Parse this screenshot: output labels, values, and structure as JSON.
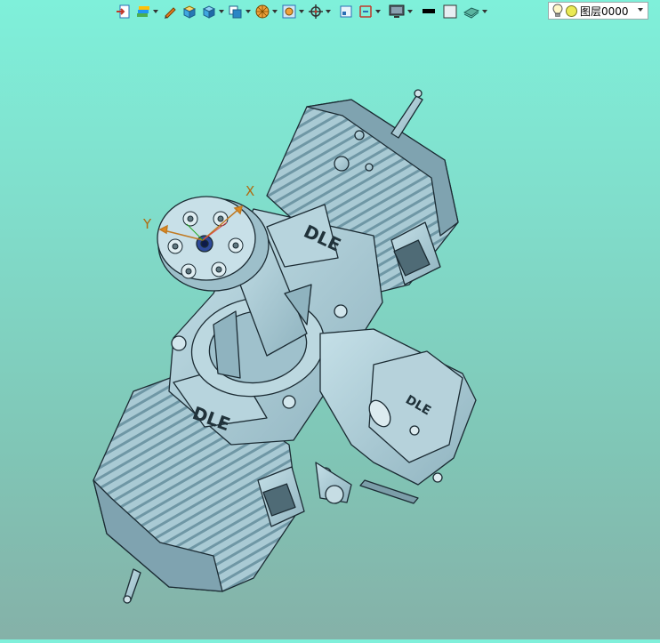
{
  "toolbar": {
    "buttons": [
      {
        "icon": "import-icon",
        "dropdown": false
      },
      {
        "icon": "layers-color-icon",
        "dropdown": true
      },
      {
        "icon": "pencil-icon",
        "dropdown": false
      },
      {
        "icon": "solid-box-icon",
        "dropdown": false
      },
      {
        "icon": "view-cube-icon",
        "dropdown": true
      },
      {
        "icon": "shaded-cube-icon",
        "dropdown": true
      },
      {
        "icon": "render-sphere-icon",
        "dropdown": true
      },
      {
        "icon": "image-frame-icon",
        "dropdown": true
      },
      {
        "icon": "crosshair-icon",
        "dropdown": true
      },
      {
        "icon": "frame-icon",
        "dropdown": false
      },
      {
        "icon": "dimension-icon",
        "dropdown": true
      },
      {
        "icon": "monitor-icon",
        "dropdown": true
      },
      {
        "icon": "line-color-icon",
        "dropdown": false
      },
      {
        "icon": "fill-color-icon",
        "dropdown": false
      },
      {
        "icon": "plane-icon",
        "dropdown": true
      }
    ]
  },
  "layer": {
    "label": "图层0000",
    "color": "#eaea55"
  },
  "model": {
    "engraving_top": "DLE",
    "engraving_bottom": "DLE",
    "engraving_carb": "DLE"
  },
  "axes": {
    "x_label": "X",
    "y_label": "Y"
  },
  "colors": {
    "background_top": "#7ff0da",
    "background_bottom": "#85b1a8",
    "model_fill": "#a8c8d2",
    "model_edge": "#1b2b33"
  }
}
